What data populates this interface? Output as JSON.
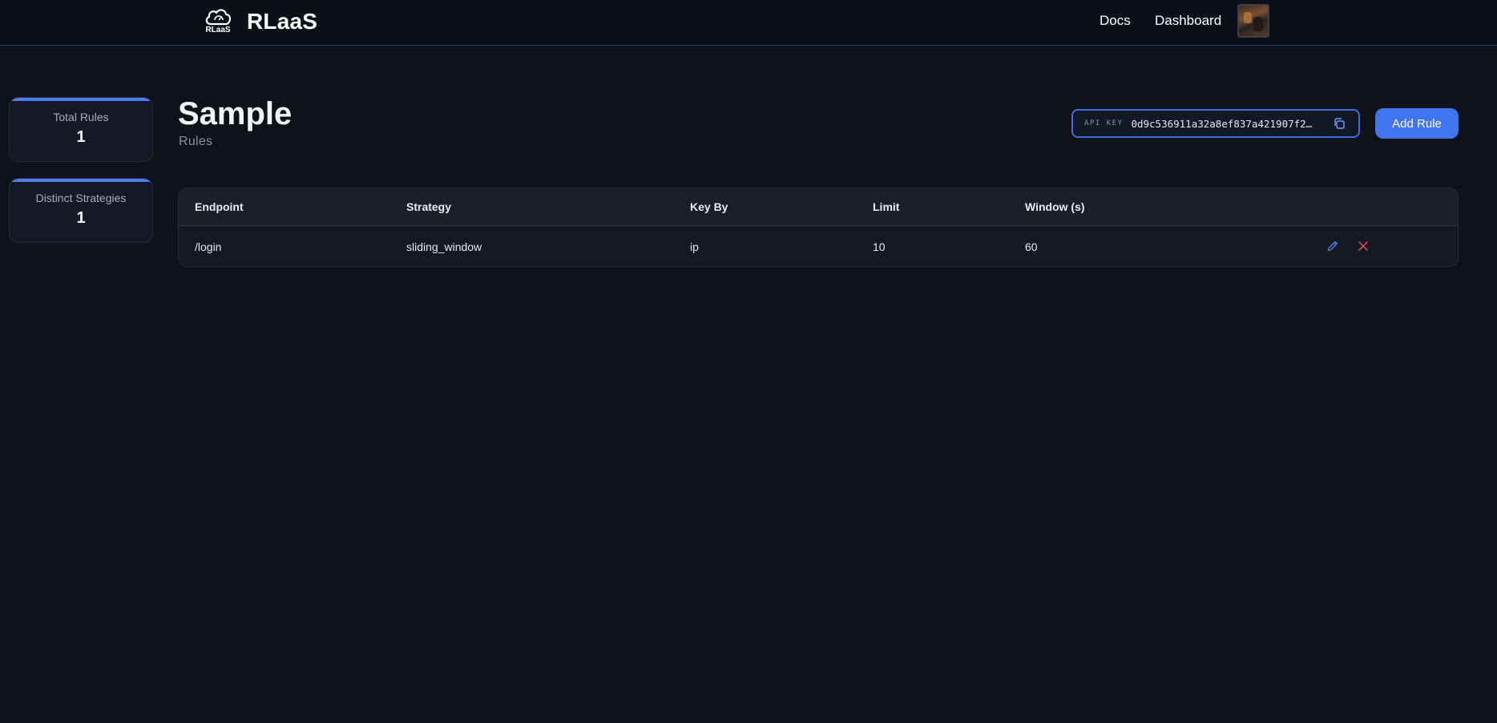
{
  "nav": {
    "brand_name": "RLaaS",
    "logo_text": "RLaaS",
    "links": [
      {
        "label": "Docs"
      },
      {
        "label": "Dashboard"
      }
    ],
    "accent_color": "#1f3a6e"
  },
  "stats": [
    {
      "label": "Total Rules",
      "value": "1"
    },
    {
      "label": "Distinct Strategies",
      "value": "1"
    }
  ],
  "header": {
    "title": "Sample",
    "subtitle": "Rules",
    "api_key_label": "API KEY",
    "api_key_value": "0d9c536911a32a8ef837a421907f2…",
    "add_rule_label": "Add Rule",
    "accent_color": "#3f76f0"
  },
  "table": {
    "columns": [
      "Endpoint",
      "Strategy",
      "Key By",
      "Limit",
      "Window (s)"
    ],
    "rows": [
      {
        "endpoint": "/login",
        "strategy": "sliding_window",
        "key_by": "ip",
        "limit": "10",
        "window": "60"
      }
    ],
    "edit_icon_color": "#4f7df0",
    "delete_icon_color": "#e05252"
  }
}
